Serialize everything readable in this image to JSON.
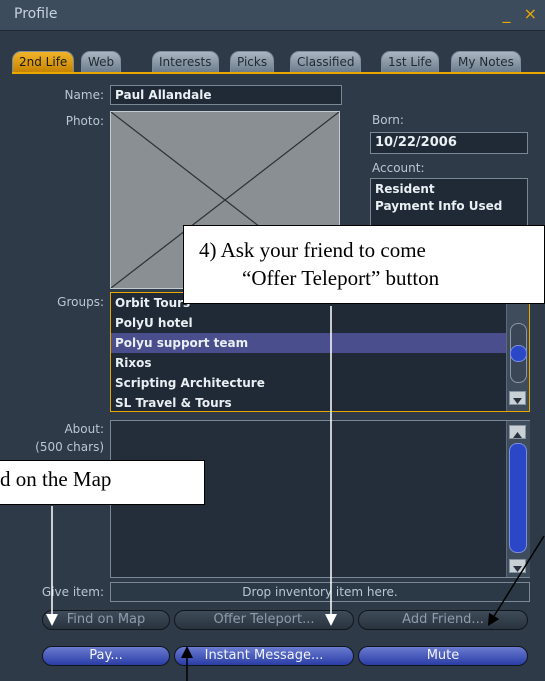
{
  "window": {
    "title": "Profile",
    "minimize_glyph": "_",
    "close_glyph": "×"
  },
  "tabs": [
    {
      "label": "2nd Life",
      "active": true
    },
    {
      "label": "Web"
    },
    {
      "label": "Interests"
    },
    {
      "label": "Picks"
    },
    {
      "label": "Classified"
    },
    {
      "label": "1st Life"
    },
    {
      "label": "My Notes"
    }
  ],
  "profile": {
    "name_label": "Name:",
    "name_value": "Paul Allandale",
    "photo_label": "Photo:",
    "born_label": "Born:",
    "born_value": "10/22/2006",
    "account_label": "Account:",
    "account_lines": [
      "Resident",
      "Payment Info Used"
    ],
    "groups_label": "Groups:",
    "groups": [
      {
        "name": "Orbit Tours"
      },
      {
        "name": "PolyU hotel"
      },
      {
        "name": "Polyu support team",
        "selected": true
      },
      {
        "name": "Rixos"
      },
      {
        "name": "Scripting Architecture"
      },
      {
        "name": "SL Travel & Tours"
      }
    ],
    "about_label": "About:",
    "about_hint": "(500 chars)",
    "give_label": "Give item:",
    "give_placeholder": "Drop inventory item here."
  },
  "buttons": {
    "find_on_map": "Find on Map",
    "offer_teleport": "Offer Teleport...",
    "add_friend": "Add Friend...",
    "pay": "Pay...",
    "instant_message": "Instant Message...",
    "mute": "Mute"
  },
  "callouts": {
    "teleport_line1": "4) Ask your friend to come",
    "teleport_line2": "“Offer Teleport” button",
    "map_text": "d on the Map"
  },
  "colors": {
    "accent": "#e8a800",
    "window_bg": "#2e3a47",
    "button_blue": "#2a3da6",
    "selection": "#4a4e8c"
  }
}
